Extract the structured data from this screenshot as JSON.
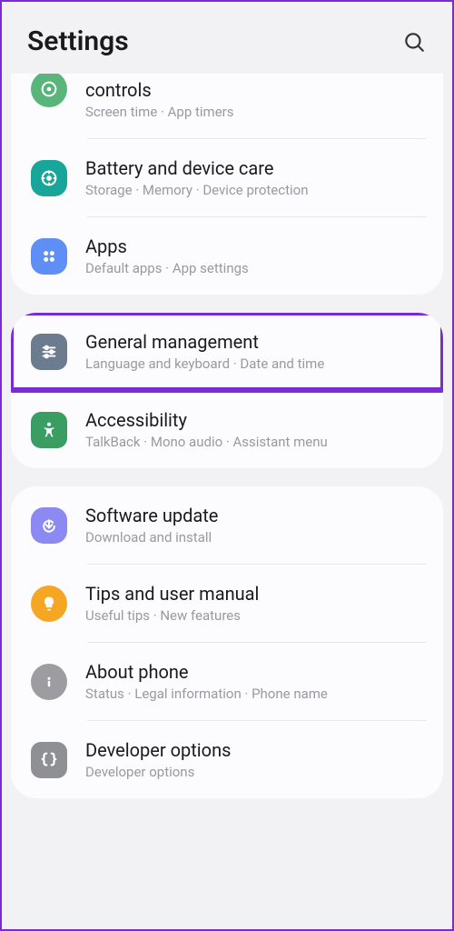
{
  "header": {
    "title": "Settings"
  },
  "group1": {
    "items": [
      {
        "title": "controls",
        "subtitle": "Screen time  ·  App timers"
      },
      {
        "title": "Battery and device care",
        "subtitle": "Storage  ·  Memory  ·  Device protection"
      },
      {
        "title": "Apps",
        "subtitle": "Default apps  ·  App settings"
      }
    ]
  },
  "group2": {
    "items": [
      {
        "title": "General management",
        "subtitle": "Language and keyboard  ·  Date and time"
      },
      {
        "title": "Accessibility",
        "subtitle": "TalkBack  ·  Mono audio  ·  Assistant menu"
      }
    ]
  },
  "group3": {
    "items": [
      {
        "title": "Software update",
        "subtitle": "Download and install"
      },
      {
        "title": "Tips and user manual",
        "subtitle": "Useful tips  ·  New features"
      },
      {
        "title": "About phone",
        "subtitle": "Status  ·  Legal information  ·  Phone name"
      },
      {
        "title": "Developer options",
        "subtitle": "Developer options"
      }
    ]
  }
}
